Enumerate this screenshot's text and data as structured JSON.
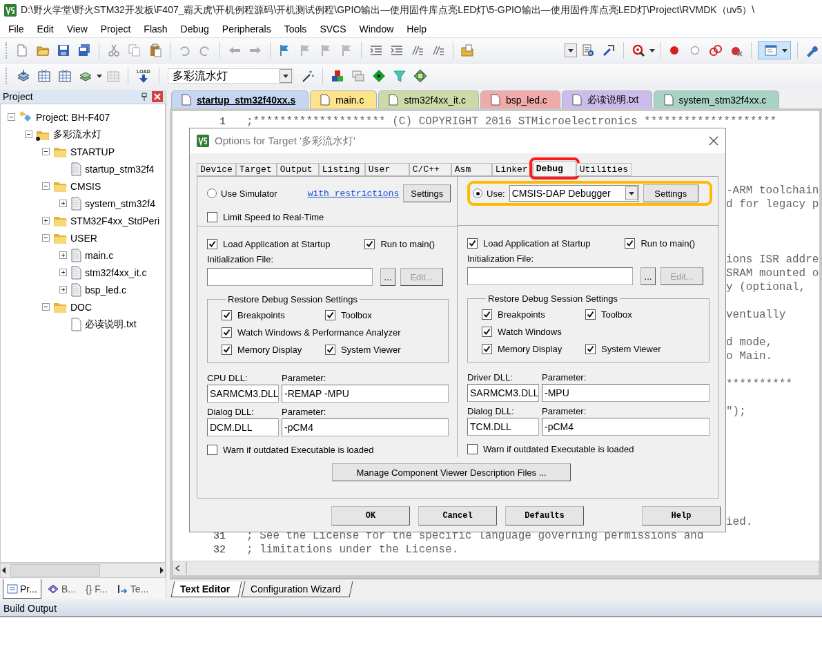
{
  "window": {
    "title": "D:\\野火学堂\\野火STM32开发板\\F407_霸天虎\\开机例程源码\\开机测试例程\\GPIO输出—使用固件库点亮LED灯\\5-GPIO输出—使用固件库点亮LED灯\\Project\\RVMDK（uv5）\\"
  },
  "menu": [
    "File",
    "Edit",
    "View",
    "Project",
    "Flash",
    "Debug",
    "Peripherals",
    "Tools",
    "SVCS",
    "Window",
    "Help"
  ],
  "toolbar": {
    "load_label": "LOAD",
    "target_combo": {
      "value": "多彩流水灯"
    }
  },
  "project_panel": {
    "title": "Project",
    "tree": [
      {
        "label": "Project: BH-F407",
        "kind": "project",
        "expanded": true,
        "children": [
          {
            "label": "多彩流水灯",
            "kind": "target",
            "expanded": true,
            "children": [
              {
                "label": "STARTUP",
                "kind": "group",
                "expanded": true,
                "children": [
                  {
                    "label": "startup_stm32f4",
                    "kind": "file"
                  }
                ]
              },
              {
                "label": "CMSIS",
                "kind": "group",
                "expanded": true,
                "children": [
                  {
                    "label": "system_stm32f4",
                    "kind": "file",
                    "expanded": false
                  }
                ]
              },
              {
                "label": "STM32F4xx_StdPeri",
                "kind": "group",
                "expanded": false
              },
              {
                "label": "USER",
                "kind": "group",
                "expanded": true,
                "children": [
                  {
                    "label": "main.c",
                    "kind": "file",
                    "expanded": false
                  },
                  {
                    "label": "stm32f4xx_it.c",
                    "kind": "file",
                    "expanded": false
                  },
                  {
                    "label": "bsp_led.c",
                    "kind": "file",
                    "expanded": false
                  }
                ]
              },
              {
                "label": "DOC",
                "kind": "group",
                "expanded": true,
                "children": [
                  {
                    "label": "必读说明.txt",
                    "kind": "text"
                  }
                ]
              }
            ]
          }
        ]
      }
    ],
    "bottom_tabs": [
      {
        "label": "Pr...",
        "kind": "project",
        "selected": true
      },
      {
        "label": "B...",
        "kind": "books",
        "selected": false
      },
      {
        "label": "{} F...",
        "kind": "functions",
        "selected": false
      },
      {
        "label": "Te...",
        "kind": "templates",
        "selected": false
      }
    ]
  },
  "editor": {
    "tabs": [
      {
        "label": "startup_stm32f40xx.s",
        "selected": true,
        "color": "#c6d6f2"
      },
      {
        "label": "main.c",
        "selected": false,
        "color": "#fde38a"
      },
      {
        "label": "stm32f4xx_it.c",
        "selected": false,
        "color": "#cbdaa6"
      },
      {
        "label": "bsp_led.c",
        "selected": false,
        "color": "#f2a9a9"
      },
      {
        "label": "必读说明.txt",
        "selected": false,
        "color": "#cdbbeb"
      },
      {
        "label": "system_stm32f4xx.c",
        "selected": false,
        "color": "#a8d2c2"
      }
    ],
    "lines": [
      {
        "kind": "full",
        "number": "1",
        "text": ";******************** (C) COPYRIGHT 2016 STMicroelectronics ********************"
      },
      {
        "kind": "hidden"
      },
      {
        "kind": "hidden"
      },
      {
        "kind": "hidden"
      },
      {
        "kind": "hidden"
      },
      {
        "kind": "tail",
        "text": "-ARM toolchain"
      },
      {
        "kind": "tail",
        "text": "d for legacy p"
      },
      {
        "kind": "hidden"
      },
      {
        "kind": "hidden"
      },
      {
        "kind": "hidden"
      },
      {
        "kind": "tail",
        "text": "ions ISR addre"
      },
      {
        "kind": "tail",
        "text": "SRAM mounted o"
      },
      {
        "kind": "tail",
        "text": "y (optional,"
      },
      {
        "kind": "hidden"
      },
      {
        "kind": "tail",
        "text": "ventually"
      },
      {
        "kind": "hidden"
      },
      {
        "kind": "tail",
        "text": "d mode,"
      },
      {
        "kind": "tail",
        "text": "o Main."
      },
      {
        "kind": "hidden"
      },
      {
        "kind": "tail",
        "text": "**********"
      },
      {
        "kind": "hidden"
      },
      {
        "kind": "tail",
        "text": "\");"
      },
      {
        "kind": "hidden"
      },
      {
        "kind": "hidden"
      },
      {
        "kind": "hidden"
      },
      {
        "kind": "hidden"
      },
      {
        "kind": "hidden"
      },
      {
        "kind": "hidden"
      },
      {
        "kind": "hidden"
      },
      {
        "kind": "tail",
        "text": "ied."
      },
      {
        "kind": "full",
        "number": "31",
        "text": "; See the License for the specific language governing permissions and"
      },
      {
        "kind": "full",
        "number": "32",
        "text": "; limitations under the License."
      }
    ],
    "view_tabs": [
      {
        "label": "Text Editor",
        "selected": true
      },
      {
        "label": "Configuration Wizard",
        "selected": false
      }
    ]
  },
  "dialog": {
    "title": "Options for Target '多彩流水灯'",
    "tabs": [
      {
        "label": "Device",
        "selected": false,
        "highlighted": false
      },
      {
        "label": "Target",
        "selected": false,
        "highlighted": false
      },
      {
        "label": "Output",
        "selected": false,
        "highlighted": false
      },
      {
        "label": "Listing",
        "selected": false,
        "highlighted": false
      },
      {
        "label": "User",
        "selected": false,
        "highlighted": false
      },
      {
        "label": "C/C++",
        "selected": false,
        "highlighted": false
      },
      {
        "label": "Asm",
        "selected": false,
        "highlighted": false
      },
      {
        "label": "Linker",
        "selected": false,
        "highlighted": false
      },
      {
        "label": "Debug",
        "selected": true,
        "highlighted": true
      },
      {
        "label": "Utilities",
        "selected": false,
        "highlighted": false
      }
    ],
    "columns": [
      {
        "target": {
          "kind": "simulator",
          "selected": false,
          "label": "Use Simulator",
          "link": "with restrictions",
          "button": "Settings",
          "highlighted": false
        },
        "options": [
          {
            "label": "Limit Speed to Real-Time",
            "checked": false
          }
        ],
        "load_app": {
          "label": "Load Application at Startup",
          "checked": true
        },
        "run_to_main": {
          "label": "Run to main()",
          "checked": true
        },
        "init_file": {
          "label": "Initialization File:",
          "browse": "...",
          "edit": "Edit...",
          "edit_disabled": true
        },
        "restore": {
          "title": "Restore Debug Session Settings",
          "rows": [
            [
              {
                "label": "Breakpoints",
                "checked": true
              },
              {
                "label": "Toolbox",
                "checked": true
              }
            ],
            [
              {
                "label": "Watch Windows & Performance Analyzer",
                "checked": true
              }
            ],
            [
              {
                "label": "Memory Display",
                "checked": true
              },
              {
                "label": "System Viewer",
                "checked": true
              }
            ]
          ]
        },
        "dlls": [
          {
            "label": "CPU DLL:",
            "value": "SARMCM3.DLL",
            "param_label": "Parameter:",
            "param": "-REMAP -MPU"
          },
          {
            "label": "Dialog DLL:",
            "value": "DCM.DLL",
            "param_label": "Parameter:",
            "param": "-pCM4"
          }
        ],
        "warn": {
          "label": "Warn if outdated Executable is loaded",
          "checked": false
        }
      },
      {
        "target": {
          "kind": "driver",
          "selected": true,
          "label": "Use:",
          "value": "CMSIS-DAP Debugger",
          "button": "Settings",
          "highlighted": true
        },
        "load_app": {
          "label": "Load Application at Startup",
          "checked": true
        },
        "run_to_main": {
          "label": "Run to main()",
          "checked": true
        },
        "init_file": {
          "label": "Initialization File:",
          "browse": "...",
          "edit": "Edit...",
          "edit_disabled": true
        },
        "restore": {
          "title": "Restore Debug Session Settings",
          "rows": [
            [
              {
                "label": "Breakpoints",
                "checked": true
              },
              {
                "label": "Toolbox",
                "checked": true
              }
            ],
            [
              {
                "label": "Watch Windows",
                "checked": true
              }
            ],
            [
              {
                "label": "Memory Display",
                "checked": true
              },
              {
                "label": "System Viewer",
                "checked": true
              }
            ]
          ]
        },
        "dlls": [
          {
            "label": "Driver DLL:",
            "value": "SARMCM3.DLL",
            "param_label": "Parameter:",
            "param": "-MPU"
          },
          {
            "label": "Dialog DLL:",
            "value": "TCM.DLL",
            "param_label": "Parameter:",
            "param": "-pCM4"
          }
        ],
        "warn": {
          "label": "Warn if outdated Executable is loaded",
          "checked": false
        }
      }
    ],
    "manage_button": "Manage Component Viewer Description Files ...",
    "buttons": [
      "OK",
      "Cancel",
      "Defaults",
      "Help"
    ]
  },
  "build_output": {
    "title": "Build Output"
  }
}
